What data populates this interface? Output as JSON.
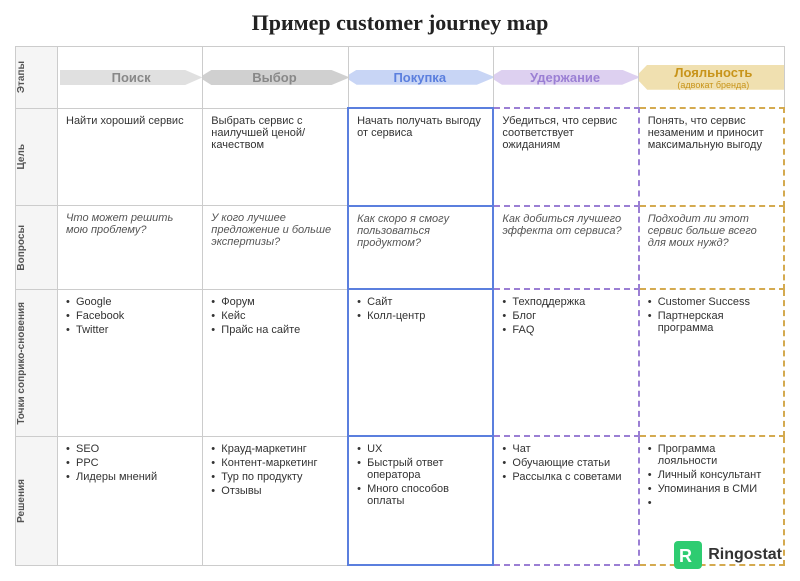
{
  "title": "Пример customer journey map",
  "logo": {
    "text": "Ringostat"
  },
  "rows": [
    {
      "label": "Этапы"
    },
    {
      "label": "Цель"
    },
    {
      "label": "Вопросы"
    },
    {
      "label": "Точки соприко-сновения"
    },
    {
      "label": "Решения"
    }
  ],
  "stages": [
    {
      "label": "Поиск",
      "sublabel": ""
    },
    {
      "label": "Выбор",
      "sublabel": ""
    },
    {
      "label": "Покупка",
      "sublabel": ""
    },
    {
      "label": "Удержание",
      "sublabel": ""
    },
    {
      "label": "Лояльность",
      "sublabel": "(адвокат бренда)"
    }
  ],
  "cells": {
    "goal": {
      "search": "Найти хороший сервис",
      "vybor": "Выбрать сервис с наилучшей ценой/качеством",
      "pokupka": "Начать получать выгоду от сервиса",
      "uderzhanie": "Убедиться, что сервис соответствует ожиданиям",
      "loyalnost": "Понять, что сервис незаменим и приносит максимальную выгоду"
    },
    "questions": {
      "search": "Что может решить мою проблему?",
      "vybor": "У кого лучшее предложение и больше экспертизы?",
      "pokupka": "Как скоро я смогу пользоваться продуктом?",
      "uderzhanie": "Как добиться лучшего эффекта от сервиса?",
      "loyalnost": "Подходит ли этот сервис больше всего для моих нужд?"
    },
    "touchpoints": {
      "search": [
        "Google",
        "Facebook",
        "Twitter"
      ],
      "vybor": [
        "Форум",
        "Кейс",
        "Прайс на сайте"
      ],
      "pokupka": [
        "Сайт",
        "Колл-центр"
      ],
      "uderzhanie": [
        "Техподдержка",
        "Блог",
        "FAQ"
      ],
      "loyalnost": [
        "Customer Success",
        "Партнерская программа"
      ]
    },
    "solutions": {
      "search": [
        "SEO",
        "PPC",
        "Лидеры мнений"
      ],
      "vybor": [
        "Крауд-маркетинг",
        "Контент-маркетинг",
        "Тур по продукту",
        "Отзывы"
      ],
      "pokupka": [
        "UX",
        "Быстрый ответ оператора",
        "Много способов оплаты"
      ],
      "uderzhanie": [
        "Чат",
        "Обучающие статьи",
        "Рассылка с советами"
      ],
      "loyalnost": [
        "Программа лояльности",
        "Личный консультант",
        "Упоминания в СМИ",
        ""
      ]
    }
  }
}
